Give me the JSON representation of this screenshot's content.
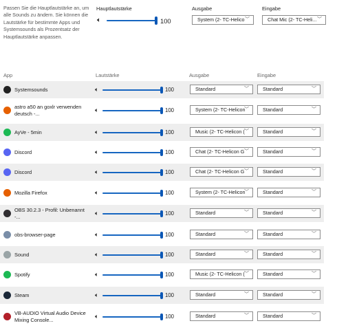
{
  "intro_text": "Passen Sie die Hauptlautstärke an, um alle Sounds zu ändern. Sie können die Lautstärke für bestimmte Apps und Systemsounds als Prozentsatz der Hauptlautstärke anpassen.",
  "master": {
    "label": "Hauptlautstärke",
    "value": "100",
    "level": 1.0
  },
  "output": {
    "label": "Ausgabe",
    "selected": "System (2- TC-Helico"
  },
  "input": {
    "label": "Eingabe",
    "selected": "Chat Mic (2- TC-Heli..."
  },
  "columns": {
    "app": "App",
    "volume": "Lautstärke",
    "output": "Ausgabe",
    "input": "Eingabe"
  },
  "apps": [
    {
      "name": "Systemsounds",
      "value": "100",
      "level": 1.0,
      "output": "Standard",
      "input": "Standard",
      "icon": "system-sounds-icon",
      "color": "#222222"
    },
    {
      "name": "astro a50 an goxlr verwenden deutsch -...",
      "value": "100",
      "level": 1.0,
      "output": "System (2- TC-Helicon",
      "input": "Standard",
      "icon": "firefox-icon",
      "color": "#e66000"
    },
    {
      "name": "AyVe - 5min",
      "value": "100",
      "level": 1.0,
      "output": "Music (2- TC-Helicon (",
      "input": "Standard",
      "icon": "spotify-icon",
      "color": "#1db954"
    },
    {
      "name": "Discord",
      "value": "100",
      "level": 1.0,
      "output": "Chat (2- TC-Helicon G",
      "input": "Standard",
      "icon": "discord-icon",
      "color": "#5865f2"
    },
    {
      "name": "Discord",
      "value": "100",
      "level": 1.0,
      "output": "Chat (2- TC-Helicon G",
      "input": "Standard",
      "icon": "discord-icon",
      "color": "#5865f2"
    },
    {
      "name": "Mozilla Firefox",
      "value": "100",
      "level": 1.0,
      "output": "System (2- TC-Helicon",
      "input": "Standard",
      "icon": "firefox-icon",
      "color": "#e66000"
    },
    {
      "name": "OBS 30.2.3 - Profil: Unbenannt -...",
      "value": "100",
      "level": 1.0,
      "output": "Standard",
      "input": "Standard",
      "icon": "obs-icon",
      "color": "#302e31"
    },
    {
      "name": "obs-browser-page",
      "value": "100",
      "level": 1.0,
      "output": "Standard",
      "input": "Standard",
      "icon": "browser-page-icon",
      "color": "#7a8ea8"
    },
    {
      "name": "Sound",
      "value": "100",
      "level": 1.0,
      "output": "Standard",
      "input": "Standard",
      "icon": "sound-icon",
      "color": "#9aa4a6"
    },
    {
      "name": "Spotify",
      "value": "100",
      "level": 1.0,
      "output": "Music (2- TC-Helicon (",
      "input": "Standard",
      "icon": "spotify-icon",
      "color": "#1db954"
    },
    {
      "name": "Steam",
      "value": "100",
      "level": 1.0,
      "output": "Standard",
      "input": "Standard",
      "icon": "steam-icon",
      "color": "#1b2838"
    },
    {
      "name": "VB-AUDIO Virtual Audio Device Mixing Console...",
      "value": "100",
      "level": 1.0,
      "output": "Standard",
      "input": "Standard",
      "icon": "vb-audio-icon",
      "color": "#b3202a"
    }
  ]
}
